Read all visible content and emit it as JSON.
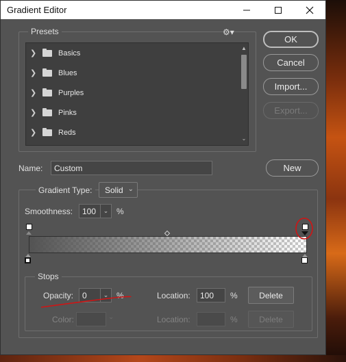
{
  "window": {
    "title": "Gradient Editor"
  },
  "presets": {
    "label": "Presets",
    "items": [
      {
        "label": "Basics"
      },
      {
        "label": "Blues"
      },
      {
        "label": "Purples"
      },
      {
        "label": "Pinks"
      },
      {
        "label": "Reds"
      }
    ]
  },
  "buttons": {
    "ok": "OK",
    "cancel": "Cancel",
    "import": "Import...",
    "export": "Export...",
    "new": "New"
  },
  "name": {
    "label": "Name:",
    "value": "Custom"
  },
  "gradient": {
    "type_label": "Gradient Type:",
    "type_value": "Solid",
    "smoothness_label": "Smoothness:",
    "smoothness_value": "100",
    "smoothness_unit": "%"
  },
  "stops": {
    "label": "Stops",
    "opacity_label": "Opacity:",
    "opacity_value": "0",
    "opacity_unit": "%",
    "opacity_location_label": "Location:",
    "opacity_location_value": "100",
    "opacity_location_unit": "%",
    "delete_label": "Delete",
    "color_label": "Color:",
    "color_location_label": "Location:",
    "color_location_unit": "%",
    "color_delete_label": "Delete"
  },
  "colors": {
    "annotation": "#d11414",
    "panel": "#535353"
  }
}
